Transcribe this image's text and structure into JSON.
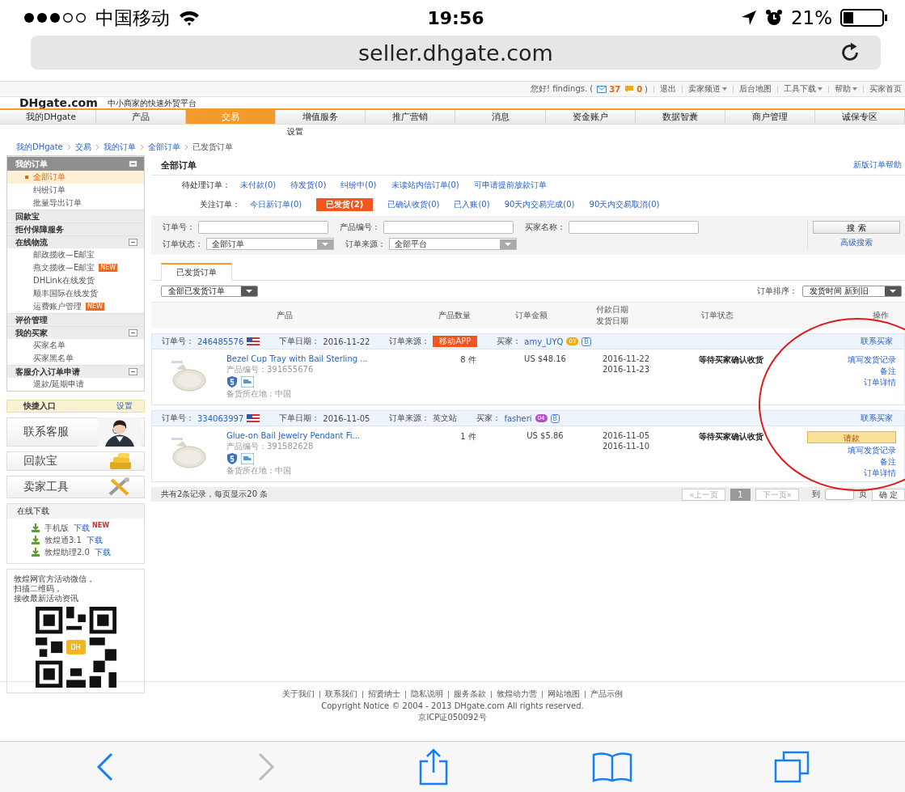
{
  "status_bar": {
    "carrier": "中国移动",
    "time": "19:56",
    "battery": "21%"
  },
  "address_bar": {
    "url": "seller.dhgate.com"
  },
  "top_bar": {
    "greeting": "您好! findings. (",
    "messages": "37",
    "comments": "0",
    "close": ")",
    "links": [
      {
        "label": "退出",
        "dropdown": false
      },
      {
        "label": "卖家频道",
        "dropdown": true
      },
      {
        "label": "后台地图",
        "dropdown": false
      },
      {
        "label": "工具下载",
        "dropdown": true
      },
      {
        "label": "帮助",
        "dropdown": true
      },
      {
        "label": "买家首页",
        "dropdown": false
      }
    ]
  },
  "logo": {
    "brand": "DHgate.com",
    "slogan": "中小商家的快速外贸平台"
  },
  "nav": [
    {
      "label": "我的DHgate",
      "selected": false
    },
    {
      "label": "产品",
      "selected": false
    },
    {
      "label": "交易",
      "selected": true
    },
    {
      "label": "增值服务",
      "selected": false
    },
    {
      "label": "推广营销",
      "selected": false
    },
    {
      "label": "消息",
      "selected": false
    },
    {
      "label": "资金账户",
      "selected": false
    },
    {
      "label": "数据智囊",
      "selected": false
    },
    {
      "label": "商户管理",
      "selected": false
    },
    {
      "label": "诚保专区",
      "selected": false
    }
  ],
  "sub_nav": [
    "设置"
  ],
  "breadcrumb": [
    "我的DHgate",
    "交易",
    "我的订单",
    "全部订单",
    "已发货订单"
  ],
  "sidebar": {
    "groups": [
      {
        "title": "我的订单",
        "kind": "main",
        "collapsible": true,
        "items": [
          {
            "label": "全部订单",
            "selected": true
          },
          {
            "label": "纠纷订单",
            "selected": false
          },
          {
            "label": "批量导出订单",
            "selected": false
          }
        ]
      },
      {
        "title": "回款宝",
        "kind": "section",
        "collapsible": false
      },
      {
        "title": "拒付保障服务",
        "kind": "section",
        "collapsible": false
      },
      {
        "title": "在线物流",
        "kind": "section",
        "collapsible": true,
        "items": [
          {
            "label": "邮政揽收—E邮宝",
            "selected": false
          },
          {
            "label": "燕文揽收—E邮宝",
            "selected": false,
            "badge": "NEW"
          },
          {
            "label": "DHLink在线发货",
            "selected": false
          },
          {
            "label": "顺丰国际在线发货",
            "selected": false
          },
          {
            "label": "运费账户管理",
            "selected": false,
            "badge": "NEW"
          }
        ]
      },
      {
        "title": "评价管理",
        "kind": "section",
        "collapsible": false
      },
      {
        "title": "我的买家",
        "kind": "section",
        "collapsible": true,
        "items": [
          {
            "label": "买家名单",
            "selected": false
          },
          {
            "label": "买家黑名单",
            "selected": false
          }
        ]
      },
      {
        "title": "客服介入订单申请",
        "kind": "section",
        "collapsible": true,
        "items": [
          {
            "label": "退款/延期申请",
            "selected": false
          }
        ]
      }
    ],
    "quick_entry": {
      "title": "快捷入口",
      "link": "设置"
    },
    "cards": [
      {
        "label": "联系客服",
        "kind": "service"
      },
      {
        "label": "回款宝",
        "kind": "coins"
      },
      {
        "label": "卖家工具",
        "kind": "tools"
      }
    ],
    "downloads": {
      "title": "在线下载",
      "items": [
        {
          "name": "手机版",
          "link": "下载",
          "badge": "NEW"
        },
        {
          "name": "敦煌通3.1",
          "link": "下载"
        },
        {
          "name": "敦煌助理2.0",
          "link": "下载"
        }
      ]
    },
    "qr_box": {
      "lines": [
        "敦煌网官方活动微信，",
        "扫描二维码，",
        "接收最新活动资讯"
      ],
      "qr_label": "DH"
    }
  },
  "main": {
    "title": "全部订单",
    "help": "新版订单帮助",
    "pending": {
      "label": "待处理订单：",
      "links": [
        "未付款(0)",
        "待发货(0)",
        "纠纷中(0)",
        "未读站内信订单(0)",
        "可申请提前放款订单"
      ]
    },
    "focus": {
      "label": "关注订单：",
      "links": [
        {
          "label": "今日新订单(0)",
          "selected": false
        },
        {
          "label": "已发货(2)",
          "selected": true
        },
        {
          "label": "已确认收货(0)",
          "selected": false
        },
        {
          "label": "已入账(0)",
          "selected": false
        },
        {
          "label": "90天内交易完成(0)",
          "selected": false
        },
        {
          "label": "90天内交易取消(0)",
          "selected": false
        }
      ]
    },
    "search": {
      "fields": [
        {
          "label": "订单号："
        },
        {
          "label": "产品编号："
        },
        {
          "label": "买家名称："
        }
      ],
      "selects": [
        {
          "label": "订单状态：",
          "value": "全部订单"
        },
        {
          "label": "订单来源：",
          "value": "全部平台"
        }
      ],
      "button": "搜 索",
      "advanced": "高级搜索"
    },
    "tabs": [
      {
        "label": "已发货订单",
        "selected": true
      }
    ],
    "filter": {
      "value": "全部已发货订单"
    },
    "sort": {
      "label": "订单排序：",
      "value": "发货时间 新到旧"
    },
    "table": {
      "columns": [
        "产品",
        "产品数量",
        "订单金额",
        [
          "付款日期",
          "发货日期"
        ],
        "订单状态",
        "操作"
      ],
      "orders": [
        {
          "order_label": "订单号：",
          "order_no": "246485576",
          "date_label": "下单日期：",
          "date": "2016-11-22",
          "source_label": "订单来源：",
          "source": "移动APP",
          "source_badge": true,
          "buyer_label": "买家：",
          "buyer": "amy_UYQ",
          "buyer_level": "03",
          "color": "#f0a81e",
          "buyer_tag": "B",
          "contact": "联系买家",
          "product": "Bezel Cup Tray with Bail Sterling ...",
          "product_no": "产品编号：391655676",
          "location": "备货所在地：中国",
          "qty": "8 件",
          "amount": "US $48.16",
          "paid": "2016-11-22",
          "shipped": "2016-11-23",
          "status": "等待买家确认收货",
          "actions": [
            "填写发货记录",
            "备注",
            "订单详情"
          ]
        },
        {
          "order_label": "订单号：",
          "order_no": "334063997",
          "date_label": "下单日期：",
          "date": "2016-11-05",
          "source_label": "订单来源：",
          "source": "英文站",
          "source_badge": false,
          "buyer_label": "买家：",
          "buyer": "fasheri",
          "buyer_level": "04",
          "color": "#b44fc8",
          "buyer_tag": "B",
          "contact": "联系买家",
          "product": "Glue-on Bail Jewelry Pendant Fi...",
          "product_no": "产品编号：391582628",
          "location": "备货所在地：中国",
          "qty": "1 件",
          "amount": "US $5.86",
          "paid": "2016-11-05",
          "shipped": "2016-11-10",
          "status": "等待买家确认收货",
          "button": "请款",
          "actions": [
            "填写发货记录",
            "备注",
            "订单详情"
          ]
        }
      ]
    },
    "pagination": {
      "summary": "共有2条记录，每页显示20 条",
      "prev": {
        "label": "«上一页",
        "disabled": true
      },
      "pages": [
        {
          "label": "1",
          "selected": true
        }
      ],
      "next": {
        "label": "下一页»",
        "disabled": true
      },
      "goto": "到",
      "page_unit": "页",
      "confirm": "确 定"
    }
  },
  "footer": {
    "links": [
      "关于我们",
      "联系我们",
      "招贤纳士",
      "隐私说明",
      "服务条款",
      "敦煌动力营",
      "网站地图",
      "产品示例"
    ],
    "copyright": "Copyright Notice © 2004 - 2013 DHgate.com All rights reserved.",
    "icp": "京ICP证050092号"
  },
  "toolbar": [
    {
      "kind": "back",
      "disabled": false
    },
    {
      "kind": "forward",
      "disabled": true
    },
    {
      "kind": "share",
      "disabled": false
    },
    {
      "kind": "bookmarks",
      "disabled": false
    },
    {
      "kind": "tabs",
      "disabled": false
    }
  ]
}
